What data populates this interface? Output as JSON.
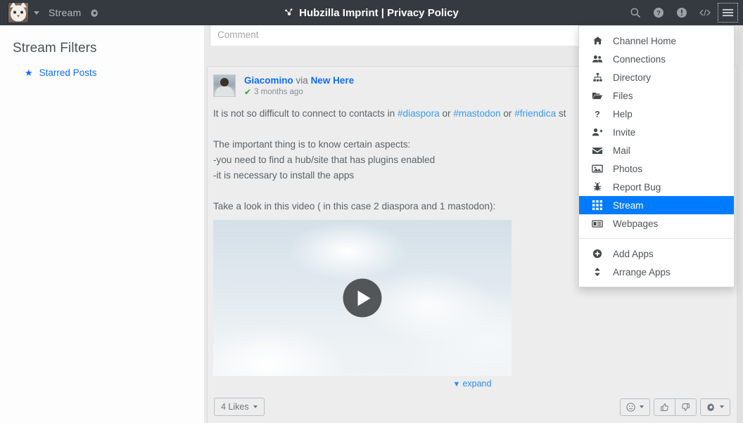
{
  "navbar": {
    "avatar_name": "cat-avatar",
    "channel_label": "Stream",
    "gear_icon": "gear-icon",
    "title": "Hubzilla Imprint | Privacy Policy",
    "title_icon": "hubzilla-icon",
    "icons": [
      {
        "name": "search-icon",
        "glyph": "search"
      },
      {
        "name": "help-icon",
        "glyph": "question-circle"
      },
      {
        "name": "info-icon",
        "glyph": "exclamation-circle"
      },
      {
        "name": "code-icon",
        "glyph": "code"
      },
      {
        "name": "hamburger-menu-icon",
        "glyph": "bars"
      }
    ]
  },
  "sidebar": {
    "heading": "Stream Filters",
    "items": [
      {
        "label": "Starred Posts",
        "icon": "star-icon"
      }
    ]
  },
  "comment": {
    "placeholder": "Comment",
    "value": ""
  },
  "post": {
    "author": "Giacomino",
    "via_label": "via",
    "channel": "New Here",
    "verified_icon": "check-icon",
    "timestamp": "3 months ago",
    "body": {
      "line1_pre": "It is not so difficult to connect to contacts in ",
      "tag1": "#diaspora",
      "sep1": " or ",
      "tag2": "#mastodon",
      "sep2": " or ",
      "tag3": "#friendica",
      "line1_post": " st",
      "line2": "The important thing is to know certain aspects:",
      "line3": "-you need to find a hub/site that has plugins enabled",
      "line4": "-it is necessary to install the apps",
      "line5": "Take a look in this video ( in this case 2 diaspora and 1 mastodon):"
    },
    "video": {
      "name": "video-thumbnail",
      "play_icon": "play-icon"
    },
    "expand_label": "expand",
    "expand_icon": "chevron-down-icon",
    "likes_label": "4 Likes",
    "actions": [
      {
        "name": "emoji-button",
        "icon": "smiley-icon"
      },
      {
        "name": "like-button",
        "icon": "thumbs-up-icon"
      },
      {
        "name": "dislike-button",
        "icon": "thumbs-down-icon"
      },
      {
        "name": "post-settings-button",
        "icon": "gear-icon"
      }
    ]
  },
  "dropdown": {
    "items": [
      {
        "label": "Channel Home",
        "icon": "home-icon",
        "active": false
      },
      {
        "label": "Connections",
        "icon": "users-icon",
        "active": false
      },
      {
        "label": "Directory",
        "icon": "sitemap-icon",
        "active": false
      },
      {
        "label": "Files",
        "icon": "folder-open-icon",
        "active": false
      },
      {
        "label": "Help",
        "icon": "question-icon",
        "active": false
      },
      {
        "label": "Invite",
        "icon": "user-plus-icon",
        "active": false
      },
      {
        "label": "Mail",
        "icon": "envelope-icon",
        "active": false
      },
      {
        "label": "Photos",
        "icon": "photo-icon",
        "active": false
      },
      {
        "label": "Report Bug",
        "icon": "bug-icon",
        "active": false
      },
      {
        "label": "Stream",
        "icon": "grid-icon",
        "active": true
      },
      {
        "label": "Webpages",
        "icon": "webpage-icon",
        "active": false
      }
    ],
    "footer_items": [
      {
        "label": "Add Apps",
        "icon": "plus-circle-icon"
      },
      {
        "label": "Arrange Apps",
        "icon": "sort-icon"
      }
    ]
  },
  "colors": {
    "navbar_bg": "#343a40",
    "accent_blue": "#0d6efd",
    "menu_active": "#007bff",
    "content_bg": "#e9e9e9",
    "card_bg": "#ededed",
    "verified_green": "#2aa534"
  }
}
